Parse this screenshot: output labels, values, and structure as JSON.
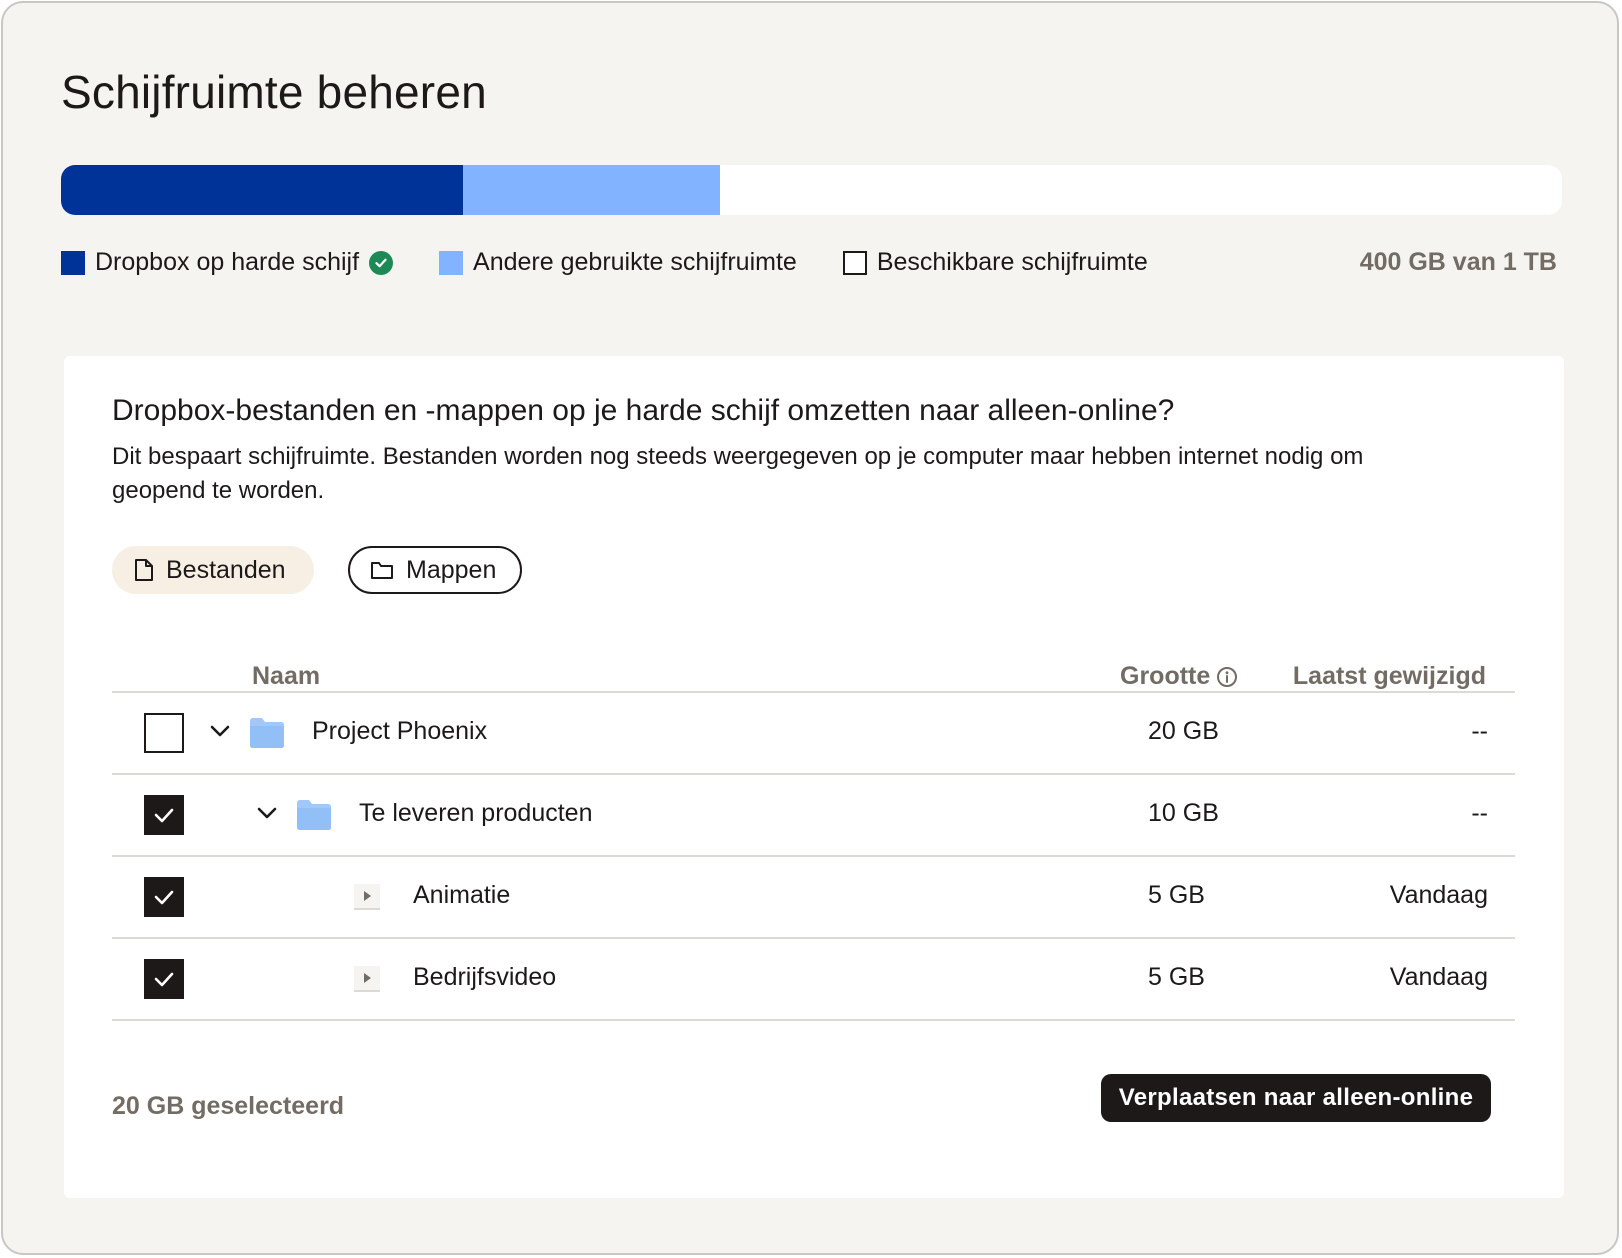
{
  "title": "Schijfruimte beheren",
  "storage": {
    "dropbox_fraction": 0.268,
    "other_fraction": 0.171,
    "colors": {
      "dropbox": "#003397",
      "other": "#82b3ff",
      "free": "#ffffff"
    },
    "legend": {
      "dropbox": "Dropbox op harde schijf",
      "other": "Andere gebruikte schijfruimte",
      "free": "Beschikbare schijfruimte"
    },
    "usage_text": "400 GB van 1 TB"
  },
  "card": {
    "title": "Dropbox-bestanden en -mappen op je harde schijf omzetten naar alleen-online?",
    "description": "Dit bespaart schijfruimte. Bestanden worden nog steeds weergegeven op je computer maar hebben internet nodig om geopend te worden.",
    "filters": {
      "files": "Bestanden",
      "folders": "Mappen",
      "active": "folders"
    }
  },
  "table": {
    "headers": {
      "name": "Naam",
      "size": "Grootte",
      "modified": "Laatst gewijzigd"
    },
    "rows": [
      {
        "name": "Project Phoenix",
        "size": "20 GB",
        "modified": "--",
        "checked": false,
        "expander": "chevron-down-icon",
        "icon": "folder-icon"
      },
      {
        "name": "Te leveren producten",
        "size": "10 GB",
        "modified": "--",
        "checked": true,
        "expander": "chevron-down-icon",
        "icon": "folder-icon"
      },
      {
        "name": "Animatie",
        "size": "5 GB",
        "modified": "Vandaag",
        "checked": true,
        "expander": "triangle-right-icon"
      },
      {
        "name": "Bedrijfsvideo",
        "size": "5 GB",
        "modified": "Vandaag",
        "checked": true,
        "expander": "triangle-right-icon"
      }
    ]
  },
  "footer": {
    "selected_text": "20 GB geselecteerd",
    "primary_button": "Verplaatsen naar alleen-online"
  }
}
